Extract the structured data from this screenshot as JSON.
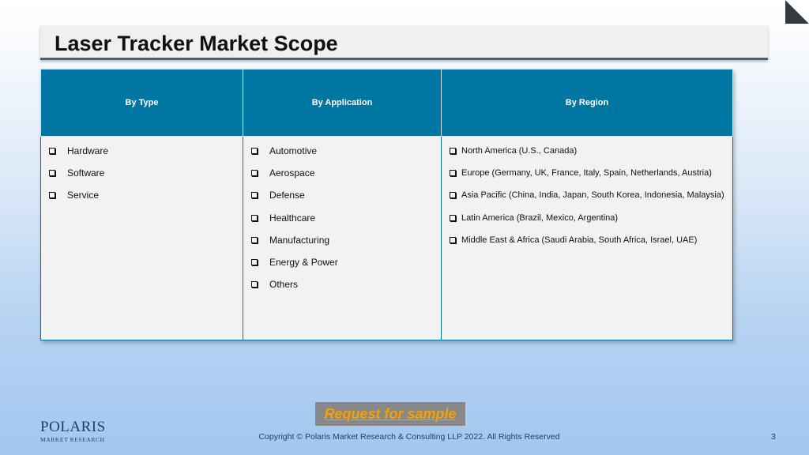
{
  "slide": {
    "title": "Laser Tracker Market Scope",
    "accent_color": "#0076a3",
    "title_underline_color": "#3d5f88"
  },
  "table": {
    "headers": [
      "By Type",
      "By Application",
      "By Region"
    ],
    "by_type": [
      "Hardware",
      "Software",
      "Service"
    ],
    "by_application": [
      "Automotive",
      "Aerospace",
      "Defense",
      "Healthcare",
      "Manufacturing",
      "Energy & Power",
      "Others"
    ],
    "by_region": [
      "North America (U.S., Canada)",
      "Europe (Germany, UK, France, Italy, Spain, Netherlands, Austria)",
      "Asia Pacific (China, India, Japan, South Korea, Indonesia, Malaysia)",
      "Latin America (Brazil, Mexico, Argentina)",
      "Middle East & Africa (Saudi Arabia, South Africa, Israel, UAE)"
    ],
    "bullet_icon": "checkbox-bullet-icon"
  },
  "footer": {
    "cta_label": "Request for sample",
    "cta_text_color": "#f5a100",
    "logo_word": "POLARIS",
    "logo_sub": "MARKET RESEARCH",
    "copyright": "Copyright © Polaris Market Research & Consulting LLP 2022. All Rights Reserved",
    "page_number": "3"
  }
}
